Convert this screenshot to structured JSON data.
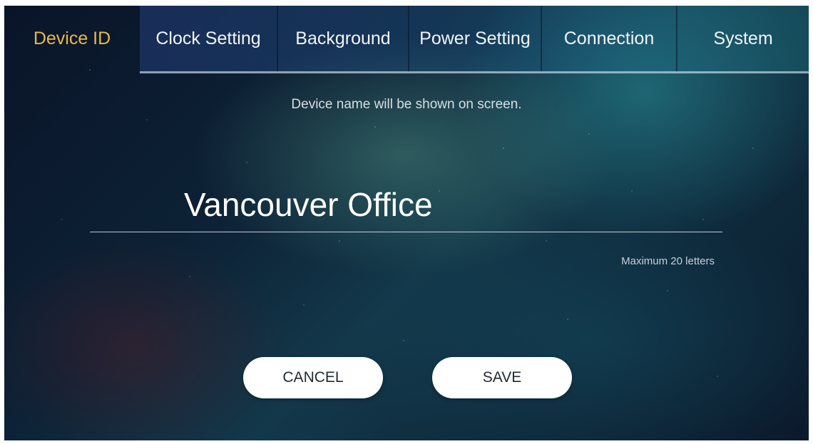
{
  "tabs": [
    {
      "label": "Device ID",
      "active": true
    },
    {
      "label": "Clock Setting",
      "active": false
    },
    {
      "label": "Background",
      "active": false
    },
    {
      "label": "Power Setting",
      "active": false
    },
    {
      "label": "Connection",
      "active": false
    },
    {
      "label": "System",
      "active": false
    }
  ],
  "device_id": {
    "hint": "Device name will be shown on screen.",
    "name_value": "Vancouver Office",
    "max_hint": "Maximum 20 letters"
  },
  "actions": {
    "cancel_label": "CANCEL",
    "save_label": "SAVE"
  },
  "colors": {
    "active_tab": "#e9b84a",
    "button_bg": "#ffffff"
  }
}
